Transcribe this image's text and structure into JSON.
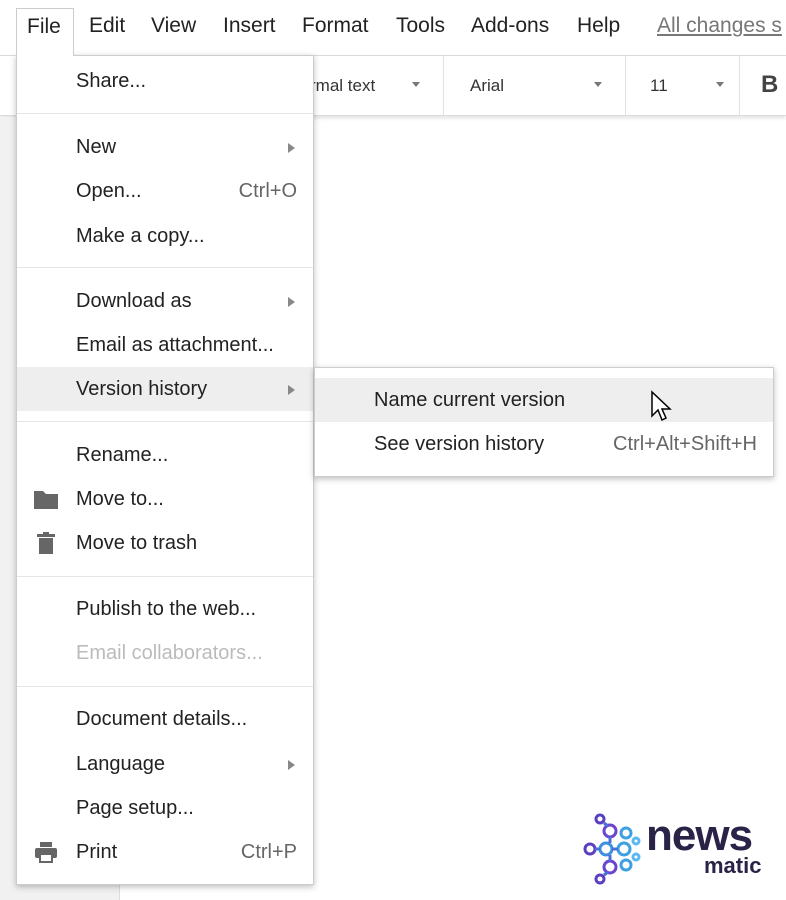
{
  "menubar": {
    "items": [
      "File",
      "Edit",
      "View",
      "Insert",
      "Format",
      "Tools",
      "Add-ons",
      "Help"
    ],
    "saved_status": "All changes s"
  },
  "toolbar": {
    "style": "rmal text",
    "font": "Arial",
    "size": "11",
    "bold": "B"
  },
  "file_menu": {
    "items": [
      {
        "label": "Share..."
      },
      {
        "label": "New",
        "submenu": true
      },
      {
        "label": "Open...",
        "shortcut": "Ctrl+O"
      },
      {
        "label": "Make a copy..."
      },
      {
        "label": "Download as",
        "submenu": true
      },
      {
        "label": "Email as attachment..."
      },
      {
        "label": "Version history",
        "submenu": true,
        "highlighted": true
      },
      {
        "label": "Rename..."
      },
      {
        "label": "Move to...",
        "icon": "folder-icon"
      },
      {
        "label": "Move to trash",
        "icon": "trash-icon"
      },
      {
        "label": "Publish to the web..."
      },
      {
        "label": "Email collaborators...",
        "disabled": true
      },
      {
        "label": "Document details..."
      },
      {
        "label": "Language",
        "submenu": true
      },
      {
        "label": "Page setup..."
      },
      {
        "label": "Print",
        "shortcut": "Ctrl+P",
        "icon": "printer-icon"
      }
    ]
  },
  "version_submenu": {
    "items": [
      {
        "label": "Name current version",
        "highlighted": true
      },
      {
        "label": "See version history",
        "shortcut": "Ctrl+Alt+Shift+H"
      }
    ]
  },
  "watermark": {
    "line1": "news",
    "line2": "matic"
  }
}
